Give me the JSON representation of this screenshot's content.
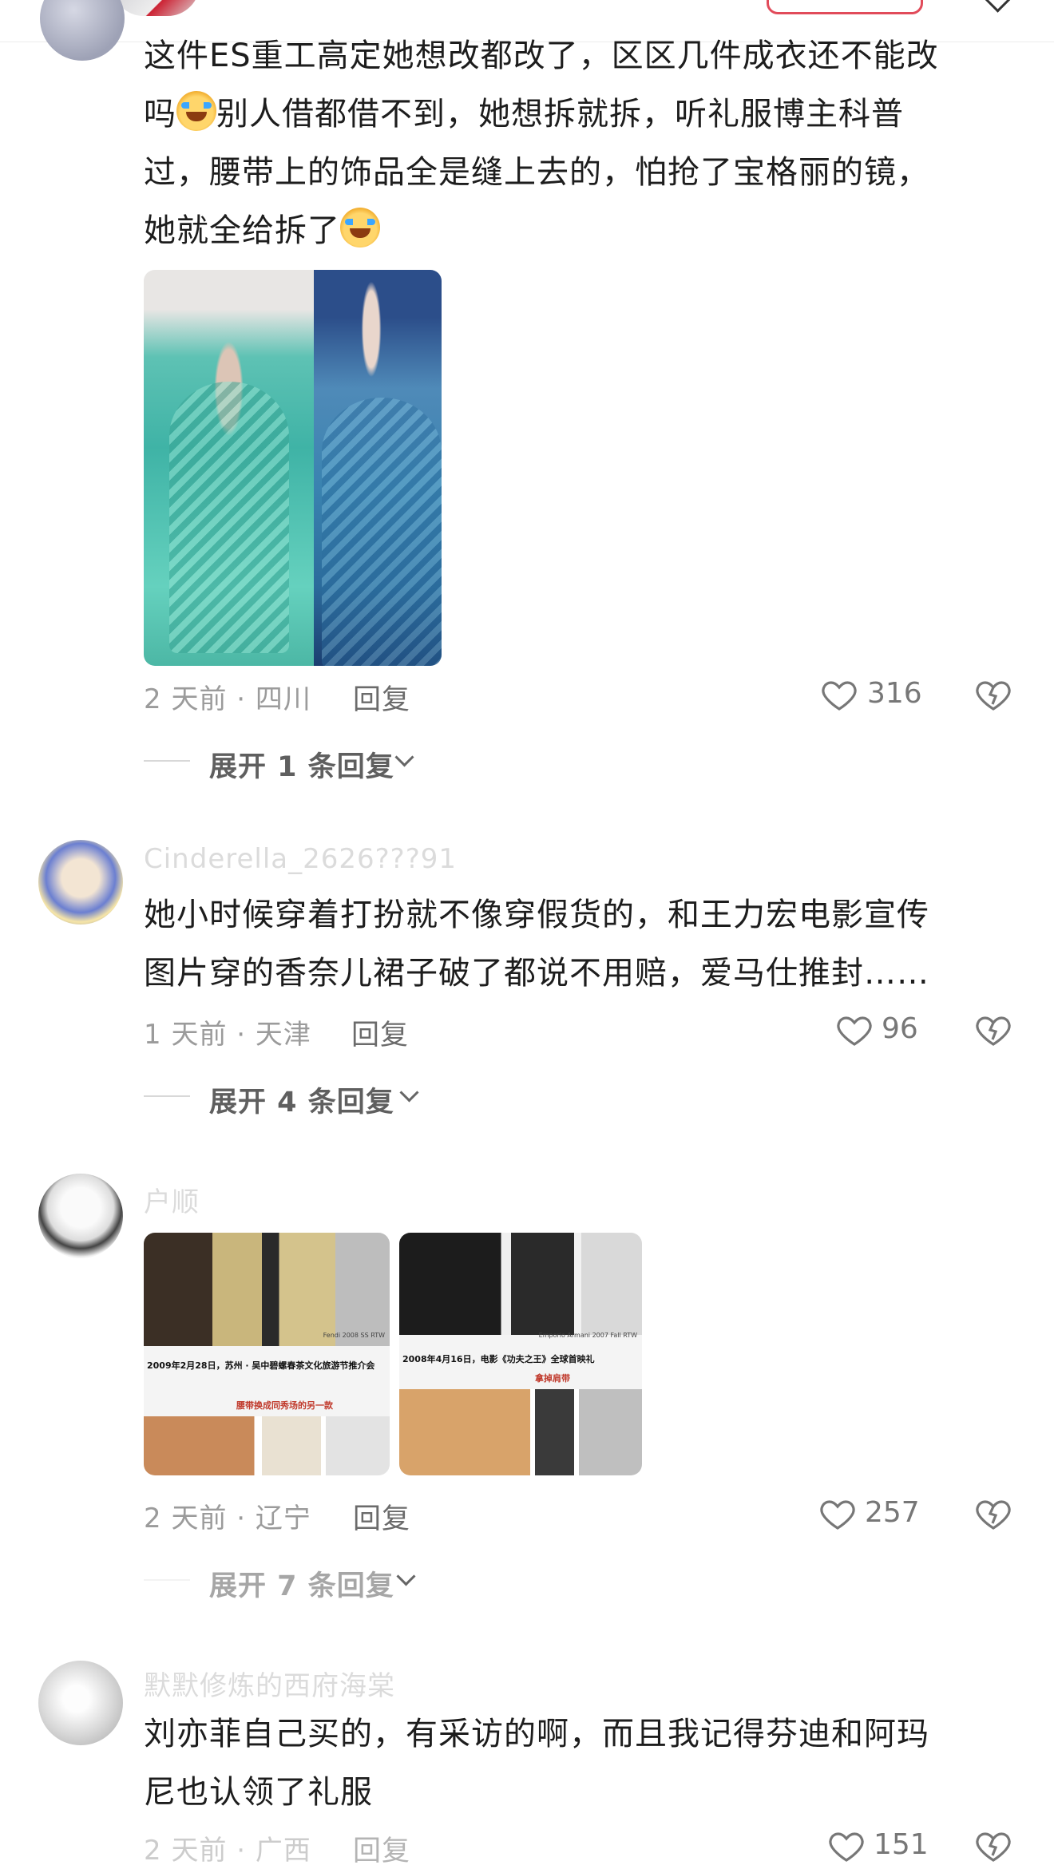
{
  "comments": [
    {
      "text_lines": [
        "这件ES重工高定她想改都改了，区区几件成衣还不能改",
        "吗",
        "别人借都借不到，她想拆就拆，听礼服博主科普",
        "过，腰带上的饰品全是缝上去的，怕抢了宝格丽的镜，",
        "她就全给拆了"
      ],
      "meta": "2 天前 · 四川",
      "reply_label": "回复",
      "likes": "316",
      "expand_label": "展开 1 条回复"
    },
    {
      "username": "Cinderella_2626???91",
      "text_lines": [
        "她小时候穿着打扮就不像穿假货的，和王力宏电影宣传",
        "图片穿的香奈儿裙子破了都说不用赔，爱马仕推封……"
      ],
      "meta": "1 天前 · 天津",
      "reply_label": "回复",
      "likes": "96",
      "expand_label": "展开 4 条回复"
    },
    {
      "username": "户顺",
      "collage1": {
        "small_label": "Fendi 2008 SS RTW",
        "caption": "2009年2月28日，苏州 · 吴中碧螺春茶文化旅游节推介会",
        "sub_caption": "腰带换成同秀场的另一款"
      },
      "collage2": {
        "small_label": "Emporio Armani 2007 Fall RTW",
        "caption": "2008年4月16日，电影《功夫之王》全球首映礼",
        "sub_caption": "拿掉肩带"
      },
      "meta": "2 天前 · 辽宁",
      "reply_label": "回复",
      "likes": "257",
      "expand_label": "展开 7 条回复"
    },
    {
      "username": "默默修炼的西府海棠",
      "text_lines": [
        "刘亦菲自己买的，有采访的啊，而且我记得芬迪和阿玛",
        "尼也认领了礼服"
      ],
      "meta_partial": "2 天前 · 广西",
      "reply_label": "回复",
      "likes": "151"
    }
  ],
  "icons": [
    "heart-icon",
    "dislike-icon",
    "chevron-down-icon"
  ],
  "colors": {
    "accent": "#e14b5a",
    "meta_gray": "#9b9b9b"
  }
}
